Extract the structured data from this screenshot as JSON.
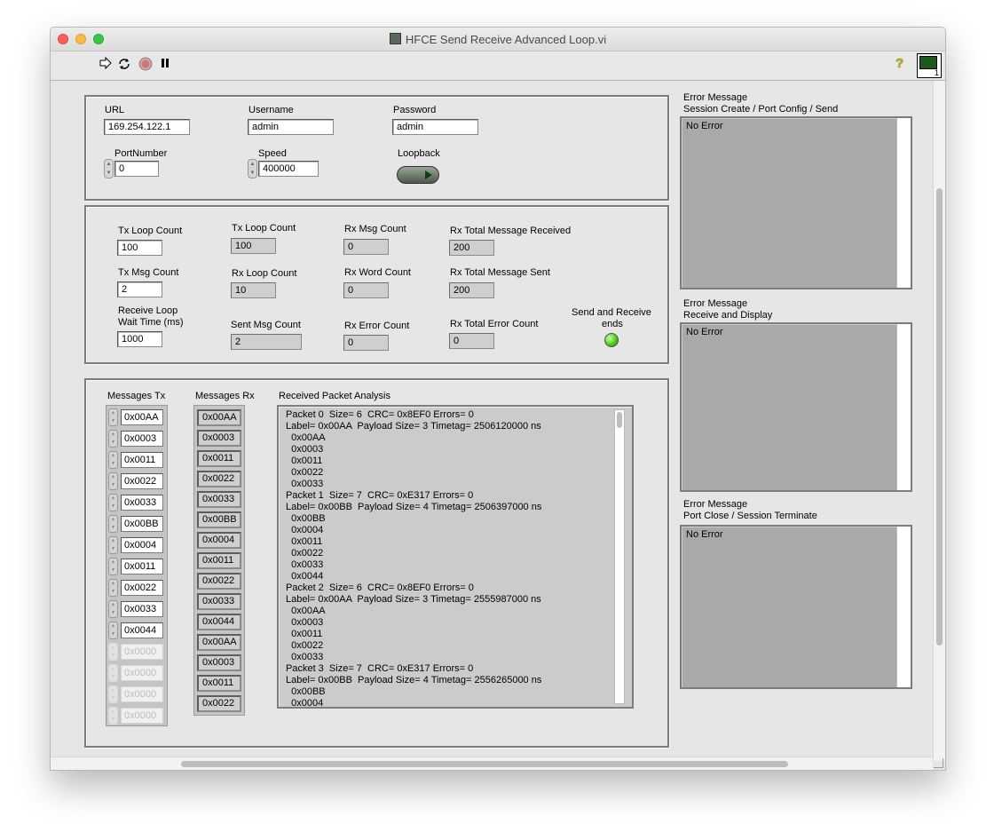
{
  "window": {
    "title": "HFCE Send Receive Advanced Loop.vi"
  },
  "toolbar": {
    "run_icon": "run-arrow-icon",
    "run_continuously_icon": "run-continuously-icon",
    "abort_icon": "abort-icon",
    "pause_icon": "pause-icon",
    "help_glyph": "?",
    "vi_icon_number": "1"
  },
  "connection": {
    "url_label": "URL",
    "url_value": "169.254.122.1",
    "username_label": "Username",
    "username_value": "admin",
    "password_label": "Password",
    "password_value": "admin",
    "port_label": "PortNumber",
    "port_value": "0",
    "speed_label": "Speed",
    "speed_value": "400000",
    "loopback_label": "Loopback"
  },
  "counts": {
    "tx_loop_count_ctrl_label": "Tx Loop Count",
    "tx_loop_count_ctrl_value": "100",
    "tx_msg_count_label": "Tx Msg Count",
    "tx_msg_count_value": "2",
    "receive_wait_label_1": "Receive Loop",
    "receive_wait_label_2": "Wait Time (ms)",
    "receive_wait_value": "1000",
    "tx_loop_count_ind_label": "Tx Loop Count",
    "tx_loop_count_ind_value": "100",
    "rx_loop_count_label": "Rx Loop Count",
    "rx_loop_count_value": "10",
    "sent_msg_count_label": "Sent Msg Count",
    "sent_msg_count_value": "2",
    "rx_msg_count_label": "Rx Msg Count",
    "rx_msg_count_value": "0",
    "rx_word_count_label": "Rx Word Count",
    "rx_word_count_value": "0",
    "rx_error_count_label": "Rx Error Count",
    "rx_error_count_value": "0",
    "rx_total_received_label": "Rx Total Message Received",
    "rx_total_received_value": "200",
    "rx_total_sent_label": "Rx Total Message Sent",
    "rx_total_sent_value": "200",
    "rx_total_error_label": "Rx Total Error Count",
    "rx_total_error_value": "0",
    "send_receive_ends_label_1": "Send and Receive",
    "send_receive_ends_label_2": "ends",
    "send_receive_ends_state": true,
    "led_color": "#49d014"
  },
  "messages": {
    "tx_label": "Messages Tx",
    "rx_label": "Messages Rx",
    "analysis_label": "Received Packet Analysis",
    "tx_items": [
      "0x00AA",
      "0x0003",
      "0x0011",
      "0x0022",
      "0x0033",
      "0x00BB",
      "0x0004",
      "0x0011",
      "0x0022",
      "0x0033",
      "0x0044",
      "0x0000",
      "0x0000",
      "0x0000",
      "0x0000"
    ],
    "rx_items": [
      "0x00AA",
      "0x0003",
      "0x0011",
      "0x0022",
      "0x0033",
      "0x00BB",
      "0x0004",
      "0x0011",
      "0x0022",
      "0x0033",
      "0x0044",
      "0x00AA",
      "0x0003",
      "0x0011",
      "0x0022"
    ],
    "analysis_text": "Packet 0  Size= 6  CRC= 0x8EF0 Errors= 0\nLabel= 0x00AA  Payload Size= 3 Timetag= 2506120000 ns\n  0x00AA\n  0x0003\n  0x0011\n  0x0022\n  0x0033\nPacket 1  Size= 7  CRC= 0xE317 Errors= 0\nLabel= 0x00BB  Payload Size= 4 Timetag= 2506397000 ns\n  0x00BB\n  0x0004\n  0x0011\n  0x0022\n  0x0033\n  0x0044\nPacket 2  Size= 6  CRC= 0x8EF0 Errors= 0\nLabel= 0x00AA  Payload Size= 3 Timetag= 2555987000 ns\n  0x00AA\n  0x0003\n  0x0011\n  0x0022\n  0x0033\nPacket 3  Size= 7  CRC= 0xE317 Errors= 0\nLabel= 0x00BB  Payload Size= 4 Timetag= 2556265000 ns\n  0x00BB\n  0x0004"
  },
  "errors": [
    {
      "title_1": "Error Message",
      "title_2": "Session Create / Port Config / Send",
      "text": "No Error"
    },
    {
      "title_1": "Error Message",
      "title_2": "Receive and Display",
      "text": "No Error"
    },
    {
      "title_1": "Error Message",
      "title_2": "Port Close / Session Terminate",
      "text": "No Error"
    }
  ]
}
